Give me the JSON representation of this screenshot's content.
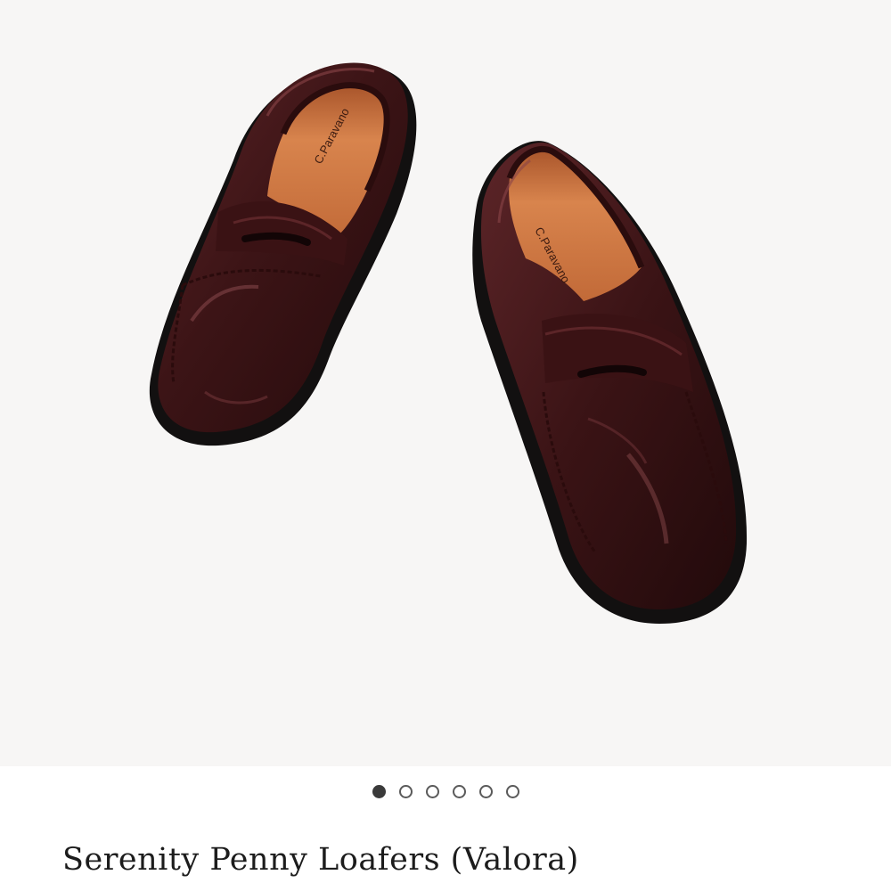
{
  "product": {
    "title": "Serenity Penny Loafers (Valora)",
    "insole_brand": "C.Paravano"
  },
  "gallery": {
    "slide_count": 6,
    "active_index": 0,
    "icons": [
      "slide-dot-active",
      "slide-dot"
    ]
  },
  "colors": {
    "leather": "#3d1416",
    "lining": "#c9703e",
    "sole": "#141212",
    "background": "#f7f6f5"
  }
}
